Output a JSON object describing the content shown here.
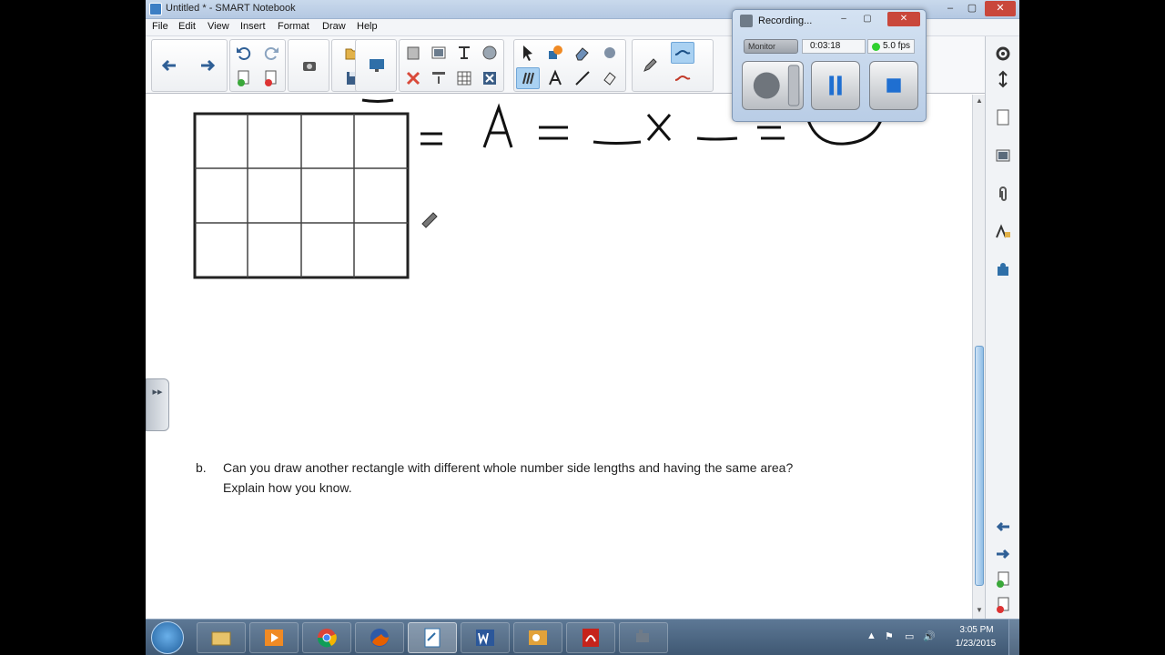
{
  "window": {
    "title": "Untitled * - SMART Notebook",
    "min": "–",
    "max": "▢",
    "close": "✕"
  },
  "menu": [
    "File",
    "Edit",
    "View",
    "Insert",
    "Format",
    "Draw",
    "Help"
  ],
  "toolbar": {
    "icons": [
      "back-arrow",
      "forward-arrow",
      "undo",
      "redo",
      "add-page",
      "delete-page",
      "screen-capture",
      "open-file",
      "save",
      "screen-shade",
      "delete",
      "table",
      "select-pen",
      "shapes",
      "eraser",
      "magic-pen",
      "creative-pen",
      "text",
      "line",
      "fill",
      "pen",
      "line-style"
    ],
    "accent": "#2f5f96"
  },
  "recorder": {
    "title": "Recording...",
    "source": "Monitor",
    "elapsed": "0:03:18",
    "fps": "5.0 fps",
    "min": "–",
    "max": "▢",
    "close": "✕"
  },
  "worksheet": {
    "handwriting_row": "=  A  =  __ x __  =",
    "question_letter": "b.",
    "question_line1": "Can you draw another rectangle with different whole number side lengths and having the same area?",
    "question_line2": "Explain how you know."
  },
  "side_handle": {
    "label": "▸▸"
  },
  "scrollbar": {
    "up": "▲",
    "down": "▼"
  },
  "taskbar": {
    "apps": [
      "windows-explorer",
      "media-player",
      "chrome",
      "firefox",
      "smart-notebook",
      "word",
      "outlook",
      "acrobat",
      "recorder"
    ],
    "tray_time": "3:05 PM",
    "tray_date": "1/23/2015",
    "tray_icons": [
      "▲",
      "⚑",
      "▭",
      "🔊"
    ]
  }
}
